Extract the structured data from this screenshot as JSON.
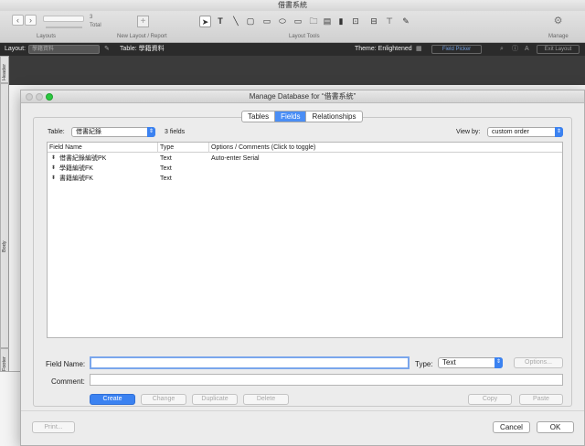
{
  "window": {
    "title": "借書系統"
  },
  "toolbar": {
    "record_count": "3",
    "total_label": "Total",
    "layouts_label": "Layouts",
    "new_layout_label": "New Layout / Report",
    "layout_tools_label": "Layout Tools",
    "manage_label": "Manage"
  },
  "layout_bar": {
    "layout_label": "Layout:",
    "layout_value": "學籍資料",
    "table_label": "Table: 學籍資料",
    "theme_label": "Theme: Enlightened",
    "field_picker_label": "Field Picker",
    "exit_layout_label": "Exit Layout",
    "font_icon_text": "A"
  },
  "parts": {
    "header": "Header",
    "body": "Body",
    "footer": "Footer"
  },
  "dialog": {
    "title": "Manage Database for “借書系統”",
    "tabs": [
      {
        "label": "Tables",
        "active": false
      },
      {
        "label": "Fields",
        "active": true
      },
      {
        "label": "Relationships",
        "active": false
      }
    ],
    "table_label": "Table:",
    "table_value": "借書紀錄",
    "fields_count": "3 fields",
    "view_by_label": "View by:",
    "view_by_value": "custom order",
    "columns": [
      "Field Name",
      "Type",
      "Options / Comments   (Click to toggle)"
    ],
    "rows": [
      {
        "name": "借書紀錄編號PK",
        "type": "Text",
        "options": "Auto-enter Serial"
      },
      {
        "name": "學籍編號FK",
        "type": "Text",
        "options": ""
      },
      {
        "name": "書籍編號FK",
        "type": "Text",
        "options": ""
      }
    ],
    "field_name_label": "Field Name:",
    "field_name_value": "",
    "type_label": "Type:",
    "type_value": "Text",
    "options_button": "Options...",
    "comment_label": "Comment:",
    "comment_value": "",
    "buttons": {
      "create": "Create",
      "change": "Change",
      "duplicate": "Duplicate",
      "delete": "Delete",
      "copy": "Copy",
      "paste": "Paste",
      "print": "Print...",
      "cancel": "Cancel",
      "ok": "OK"
    }
  },
  "colors": {
    "accent": "#3b82f1",
    "dark_bar": "#2b2b2b"
  }
}
